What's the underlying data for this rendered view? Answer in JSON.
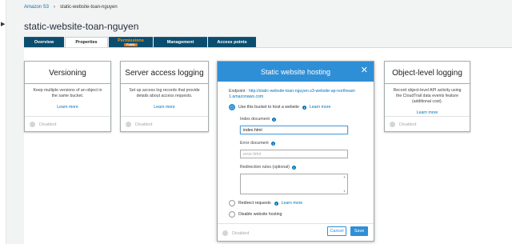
{
  "breadcrumb": {
    "root": "Amazon S3",
    "separator": "›",
    "current": "static-website-toan-nguyen"
  },
  "bucket": {
    "name": "static-website-toan-nguyen"
  },
  "tabs": [
    {
      "label": "Overview"
    },
    {
      "label": "Properties"
    },
    {
      "label": "Permissions",
      "badge": "Public"
    },
    {
      "label": "Management"
    },
    {
      "label": "Access points"
    }
  ],
  "cards": {
    "versioning": {
      "title": "Versioning",
      "desc": "Keep multiple versions of an object in the same bucket.",
      "learn": "Learn more",
      "status": "Disabled"
    },
    "logging": {
      "title": "Server access logging",
      "desc": "Set up access log records that provide details about access requests.",
      "learn": "Learn more",
      "status": "Disabled"
    },
    "object_logging": {
      "title": "Object-level logging",
      "desc": "Record object-level API activity using the CloudTrail data events feature (additional cost).",
      "learn": "Learn more",
      "status": "Disabled"
    }
  },
  "modal": {
    "title": "Static website hosting",
    "endpoint_label": "Endpoint :",
    "endpoint_url": "http://static-website-toan-nguyen.s3-website-ap-northeast-1.amazonaws.com",
    "option_host": "Use this bucket to host a website",
    "learn": "Learn more",
    "index_label": "Index document",
    "index_value": "index.html",
    "error_label": "Error document",
    "error_placeholder": "error.html",
    "redirect_rules_label": "Redirection rules (optional)",
    "option_redirect": "Redirect requests",
    "option_disable": "Disable website hosting",
    "status": "Disabled",
    "cancel": "Cancel",
    "save": "Save"
  },
  "colors": {
    "accent": "#2f8fd6",
    "tab_bg": "#0b4d6e",
    "link": "#0073bb",
    "badge": "#ec7211"
  }
}
